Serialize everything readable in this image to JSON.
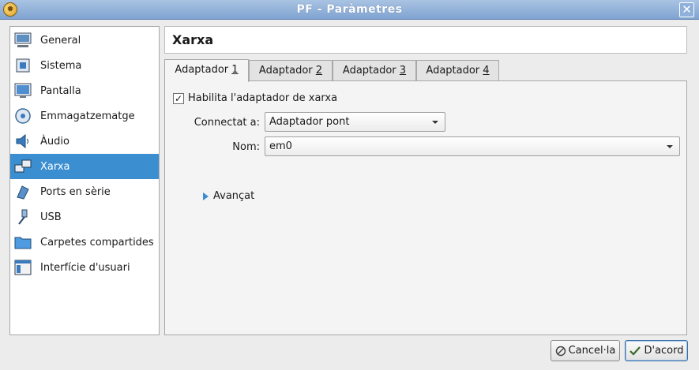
{
  "window": {
    "title": "PF - Paràmetres"
  },
  "sidebar": {
    "items": [
      {
        "label": "General",
        "icon": "monitor-icon"
      },
      {
        "label": "Sistema",
        "icon": "chip-icon"
      },
      {
        "label": "Pantalla",
        "icon": "display-icon"
      },
      {
        "label": "Emmagatzematge",
        "icon": "disk-icon"
      },
      {
        "label": "Àudio",
        "icon": "speaker-icon"
      },
      {
        "label": "Xarxa",
        "icon": "network-icon",
        "selected": true
      },
      {
        "label": "Ports en sèrie",
        "icon": "serial-port-icon"
      },
      {
        "label": "USB",
        "icon": "usb-icon"
      },
      {
        "label": "Carpetes compartides",
        "icon": "folder-icon"
      },
      {
        "label": "Interfície d'usuari",
        "icon": "window-icon"
      }
    ]
  },
  "page": {
    "title": "Xarxa"
  },
  "tabs": [
    {
      "label": "Adaptador ",
      "num": "1",
      "active": true
    },
    {
      "label": "Adaptador ",
      "num": "2"
    },
    {
      "label": "Adaptador ",
      "num": "3"
    },
    {
      "label": "Adaptador ",
      "num": "4"
    }
  ],
  "adapter": {
    "enable_label": "Habilita l'adaptador de xarxa",
    "enabled": true,
    "attached_label": "Connectat a:",
    "attached_value": "Adaptador pont",
    "name_label": "Nom:",
    "name_value": "em0",
    "advanced_label": "Avançat"
  },
  "buttons": {
    "cancel": "Cancel·la",
    "ok": "D'acord"
  },
  "colors": {
    "selection": "#3b8ed0",
    "titlebar": "#8fb0da"
  }
}
